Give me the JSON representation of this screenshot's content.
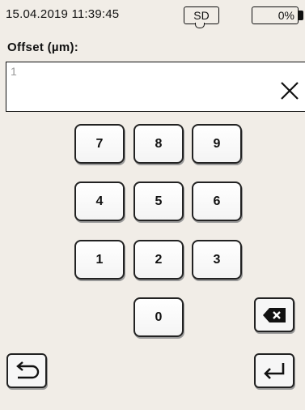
{
  "status": {
    "datetime": "15.04.2019 11:39:45",
    "storage": "SD",
    "battery": "0%"
  },
  "field": {
    "label": "Offset (µm):",
    "value": "1"
  },
  "keypad": {
    "keys": [
      "7",
      "8",
      "9",
      "4",
      "5",
      "6",
      "1",
      "2",
      "3",
      "0"
    ]
  },
  "icons": {
    "clear": "close-icon",
    "backspace": "backspace-icon",
    "back": "undo-arrow-icon",
    "enter": "enter-return-icon"
  }
}
